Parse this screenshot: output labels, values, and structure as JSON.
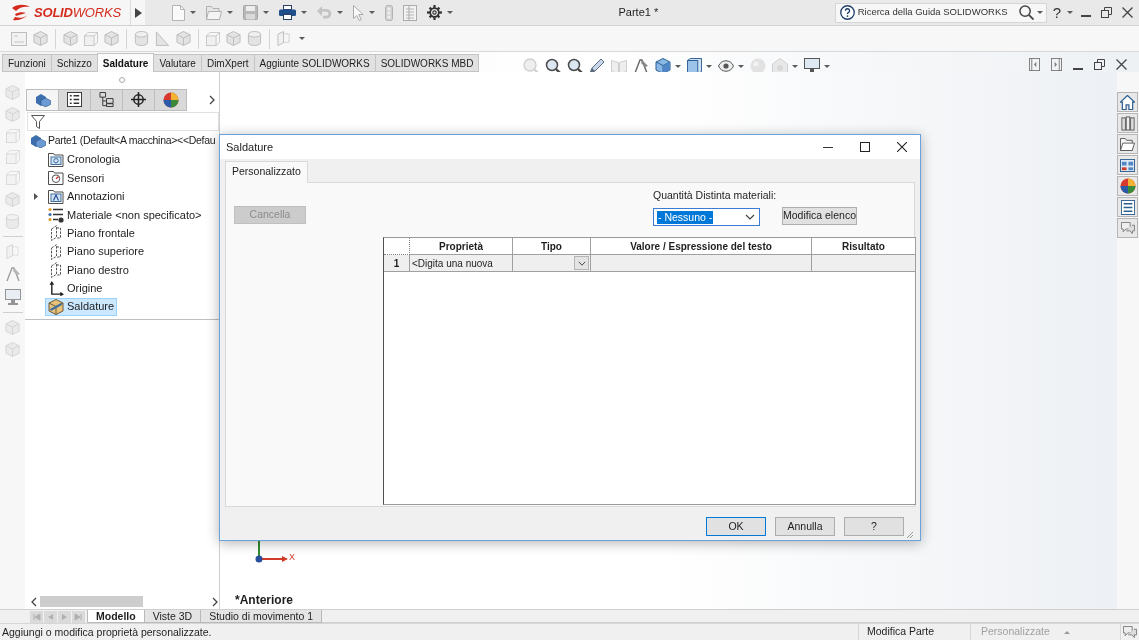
{
  "app_bar": {
    "logo": "**SOLID**WORKS",
    "document_title": "Parte1 *",
    "search": {
      "placeholder": "Ricerca della Guida SOLIDWORKS"
    },
    "help_label": "?"
  },
  "command_tabs": [
    {
      "label": "Funzioni",
      "selected": false
    },
    {
      "label": "Schizzo",
      "selected": false
    },
    {
      "label": "Saldature",
      "selected": true
    },
    {
      "label": "Valutare",
      "selected": false
    },
    {
      "label": "DimXpert",
      "selected": false
    },
    {
      "label": "Aggiunte SOLIDWORKS",
      "selected": false
    },
    {
      "label": "SOLIDWORKS MBD",
      "selected": false
    }
  ],
  "feature_manager": {
    "tabs": [
      {
        "kind": "feature-tree",
        "selected": true
      },
      {
        "kind": "property-manager",
        "selected": false
      },
      {
        "kind": "configuration-manager",
        "selected": false
      },
      {
        "kind": "dimxpert-manager",
        "selected": false
      },
      {
        "kind": "display-manager",
        "selected": false
      }
    ],
    "tree": {
      "label": "Parte1 (Default<A macchina><<Defau",
      "kind": "part",
      "children": [
        {
          "label": "Cronologia",
          "kind": "history",
          "expandable": false,
          "selected": false
        },
        {
          "label": "Sensori",
          "kind": "sensors",
          "expandable": false,
          "selected": false
        },
        {
          "label": "Annotazioni",
          "kind": "annotations",
          "expandable": true,
          "selected": false
        },
        {
          "label": "Materiale <non specificato>",
          "kind": "material",
          "expandable": false,
          "selected": false
        },
        {
          "label": "Piano frontale",
          "kind": "plane",
          "expandable": false,
          "selected": false
        },
        {
          "label": "Piano superiore",
          "kind": "plane",
          "expandable": false,
          "selected": false
        },
        {
          "label": "Piano destro",
          "kind": "plane",
          "expandable": false,
          "selected": false
        },
        {
          "label": "Origine",
          "kind": "origin",
          "expandable": false,
          "selected": false
        },
        {
          "label": "Saldature",
          "kind": "weldments",
          "expandable": false,
          "selected": true
        }
      ]
    }
  },
  "graphics": {
    "axis_label": "X",
    "view_name": "*Anteriore"
  },
  "dialog": {
    "title": "Saldature",
    "tabs": [
      {
        "label": "Personalizzato",
        "selected": true
      }
    ],
    "delete_button": {
      "label": "Cancella",
      "disabled": true
    },
    "bom_quantity": {
      "label": "Quantità Distinta materiali:",
      "value": "- Nessuno -",
      "focused": true
    },
    "edit_list_button": {
      "label": "Modifica elenco"
    },
    "table": {
      "columns": [
        "Proprietà",
        "Tipo",
        "Valore / Espressione del testo",
        "Risultato"
      ],
      "rows": [
        {
          "number": "1",
          "property": "<Digita una nuova"
        }
      ]
    },
    "buttons": [
      {
        "label": "OK",
        "default": true
      },
      {
        "label": "Annulla",
        "default": false
      },
      {
        "label": "?",
        "default": false
      }
    ]
  },
  "bottom_tabs": [
    {
      "label": "Modello",
      "selected": true
    },
    {
      "label": "Viste 3D",
      "selected": false
    },
    {
      "label": "Studio di movimento 1",
      "selected": false
    }
  ],
  "status_bar": {
    "message": "Aggiungi o modifica proprietà personalizzate.",
    "mode": "Modifica Parte",
    "properties": {
      "label": "Personalizzate",
      "disabled": true
    }
  }
}
